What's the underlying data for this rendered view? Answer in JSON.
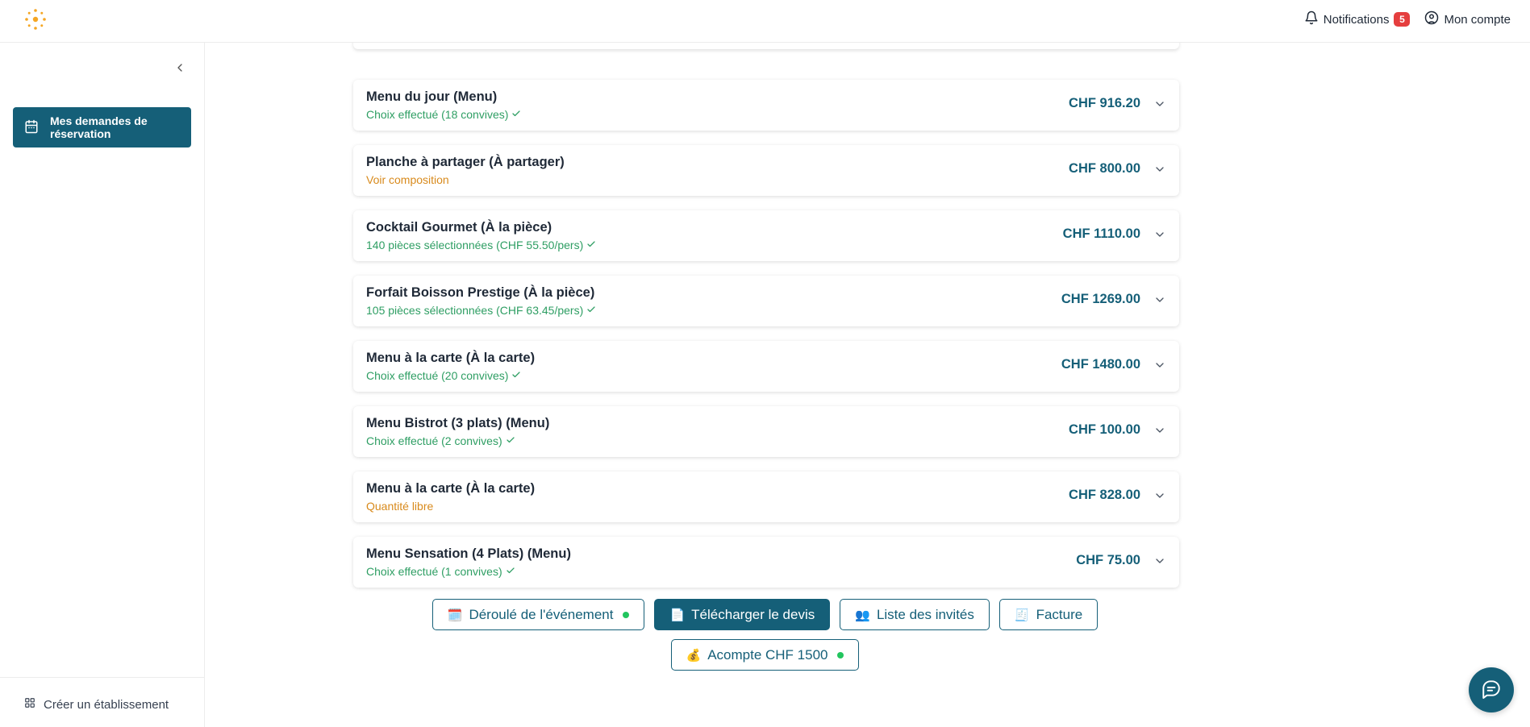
{
  "header": {
    "notifications_label": "Notifications",
    "notifications_count": "5",
    "account_label": "Mon compte"
  },
  "sidebar": {
    "items": [
      {
        "label": "Mes demandes de réservation",
        "icon": "calendar-icon"
      }
    ],
    "footer_link": "Créer un établissement"
  },
  "colors": {
    "primary": "#155f78",
    "success": "#2e9e63",
    "warning": "#d88a1c",
    "badge": "#e53e3e"
  },
  "items": [
    {
      "title": "Menu du jour (Menu)",
      "subtitle": "Choix effectué (18 convives)",
      "status": "ok",
      "price": "CHF 916.20"
    },
    {
      "title": "Planche à partager (À partager)",
      "subtitle": "Voir composition",
      "status": "warn",
      "price": "CHF 800.00"
    },
    {
      "title": "Cocktail Gourmet (À la pièce)",
      "subtitle": "140 pièces sélectionnées (CHF 55.50/pers)",
      "status": "ok",
      "price": "CHF 1110.00"
    },
    {
      "title": "Forfait Boisson Prestige (À la pièce)",
      "subtitle": "105 pièces sélectionnées (CHF 63.45/pers)",
      "status": "ok",
      "price": "CHF 1269.00"
    },
    {
      "title": "Menu à la carte (À la carte)",
      "subtitle": "Choix effectué (20 convives)",
      "status": "ok",
      "price": "CHF 1480.00"
    },
    {
      "title": "Menu Bistrot (3 plats) (Menu)",
      "subtitle": "Choix effectué (2 convives)",
      "status": "ok",
      "price": "CHF 100.00"
    },
    {
      "title": "Menu à la carte (À la carte)",
      "subtitle": "Quantité libre",
      "status": "warn",
      "price": "CHF 828.00"
    },
    {
      "title": "Menu Sensation (4 Plats) (Menu)",
      "subtitle": "Choix effectué (1 convives)",
      "status": "ok",
      "price": "CHF 75.00"
    }
  ],
  "actions": {
    "timeline": {
      "emoji": "🗓️",
      "label": "Déroulé de l'événement"
    },
    "download_quote": {
      "emoji": "📄",
      "label": "Télécharger le devis"
    },
    "guest_list": {
      "emoji": "👥",
      "label": "Liste des invités"
    },
    "invoice": {
      "emoji": "🧾",
      "label": "Facture"
    },
    "deposit": {
      "emoji": "💰",
      "label": "Acompte CHF 1500"
    }
  }
}
